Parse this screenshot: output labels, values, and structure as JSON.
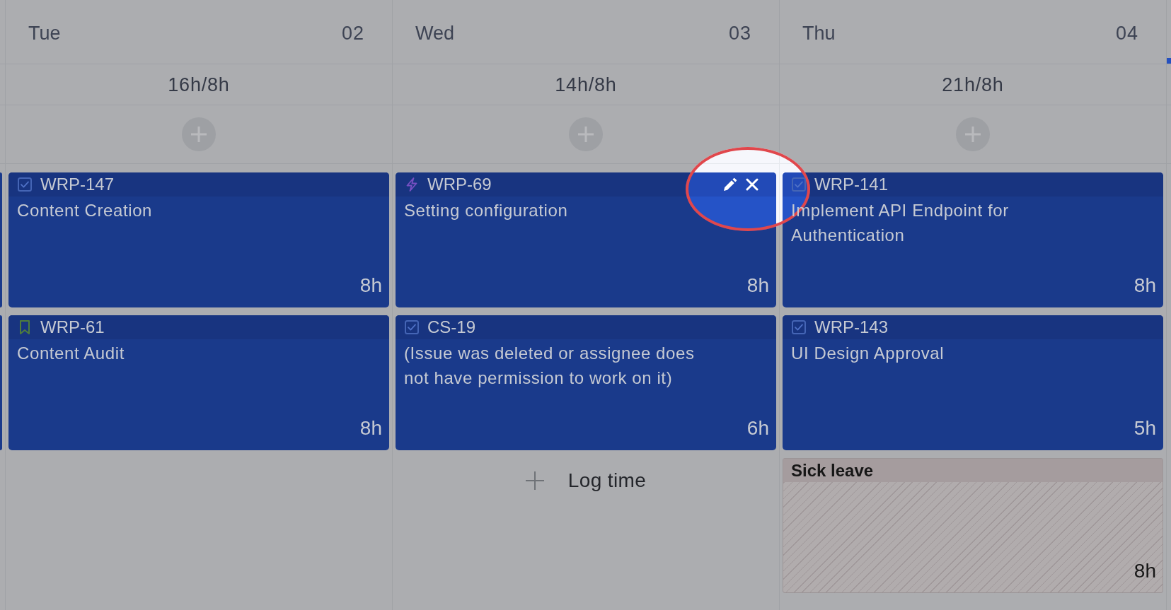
{
  "days": [
    {
      "weekday": "Tue",
      "date": "02",
      "logged": "16h/8h",
      "entries": [
        {
          "kind": "task",
          "key": "WRP-147",
          "title": "Content Creation",
          "hours": "8h",
          "highlighted": false
        },
        {
          "kind": "story",
          "key": "WRP-61",
          "title": "Content Audit",
          "hours": "8h",
          "highlighted": false
        }
      ]
    },
    {
      "weekday": "Wed",
      "date": "03",
      "logged": "14h/8h",
      "entries": [
        {
          "kind": "epic",
          "key": "WRP-69",
          "title": "Setting configuration",
          "hours": "8h",
          "highlighted": true
        },
        {
          "kind": "task",
          "key": "CS-19",
          "title": "(Issue was deleted or assignee does not have permission to work on it)",
          "hours": "6h",
          "highlighted": false
        }
      ],
      "log_time": {
        "label": "Log time"
      }
    },
    {
      "weekday": "Thu",
      "date": "04",
      "logged": "21h/8h",
      "entries": [
        {
          "kind": "task",
          "key": "WRP-141",
          "title": "Implement API Endpoint for Authentication",
          "hours": "8h",
          "highlighted": false
        },
        {
          "kind": "task",
          "key": "WRP-143",
          "title": "UI Design Approval",
          "hours": "5h",
          "highlighted": false
        },
        {
          "kind": "leave",
          "title": "Sick leave",
          "hours": "8h"
        }
      ]
    }
  ]
}
